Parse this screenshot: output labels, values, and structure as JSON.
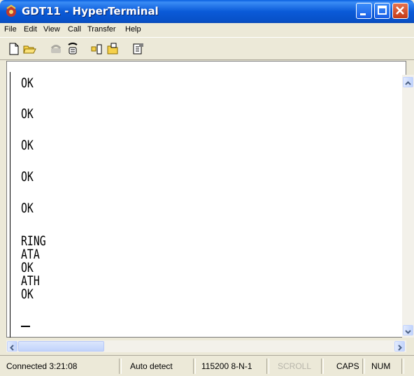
{
  "window": {
    "title": "GDT11 - HyperTerminal"
  },
  "menu": [
    "File",
    "Edit",
    "View",
    "Call",
    "Transfer",
    "Help"
  ],
  "toolbar": {
    "icons": [
      "new-document-icon",
      "open-folder-icon",
      "connect-phone-icon",
      "disconnect-phone-icon",
      "send-file-icon",
      "receive-file-icon",
      "properties-icon"
    ]
  },
  "terminal": {
    "lines": [
      "OK",
      "OK",
      "OK",
      "OK",
      "OK",
      "RING",
      "ATA",
      "OK",
      "ATH",
      "OK"
    ]
  },
  "status": {
    "connected": "Connected 3:21:08",
    "detect": "Auto detect",
    "port_settings": "115200 8-N-1",
    "scroll": "SCROLL",
    "caps": "CAPS",
    "num": "NUM"
  },
  "colors": {
    "titlebar": "#0a5ad8",
    "close_button": "#c43a17",
    "chrome": "#ece9d8",
    "terminal_bg": "#ffffff"
  }
}
